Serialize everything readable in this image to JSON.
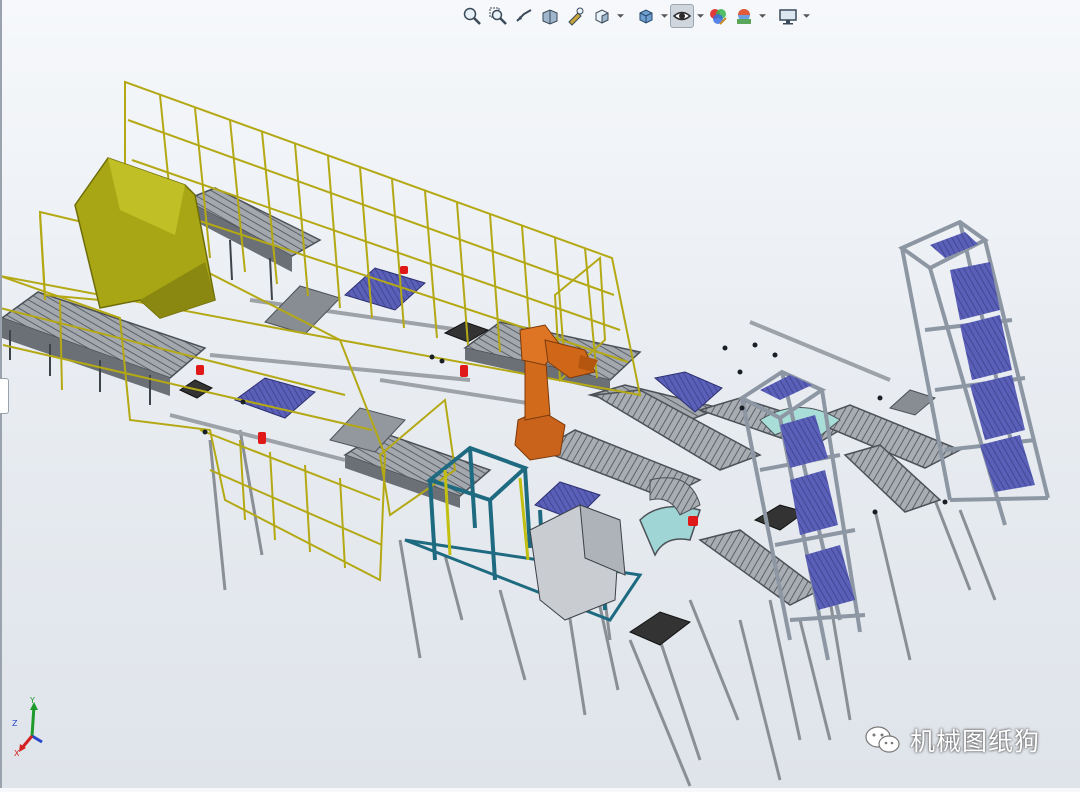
{
  "toolbar": {
    "buttons": [
      {
        "name": "zoom-to-fit-icon"
      },
      {
        "name": "zoom-to-area-icon"
      },
      {
        "name": "previous-view-icon"
      },
      {
        "name": "section-view-icon"
      },
      {
        "name": "dynamic-annotation-icon"
      },
      {
        "name": "view-orientation-icon"
      },
      {
        "name": "display-style-icon"
      },
      {
        "name": "hide-show-items-icon"
      },
      {
        "name": "edit-appearance-icon"
      },
      {
        "name": "apply-scene-icon"
      },
      {
        "name": "view-settings-icon"
      }
    ],
    "active": "hide-show-items-icon"
  },
  "triad": {
    "x": "X",
    "y": "Y",
    "z": "Z"
  },
  "watermark": {
    "text": "机械图纸狗"
  },
  "colors": {
    "guard_frame": "#b8ac12",
    "hood": "#9b9a10",
    "robot": "#d26a1c",
    "pallet": "#5b5fb5",
    "conveyor": "#9ba0a6",
    "frame_teal": "#1f6a80",
    "rack": "#8d96a3",
    "sensor": "#e01818"
  }
}
